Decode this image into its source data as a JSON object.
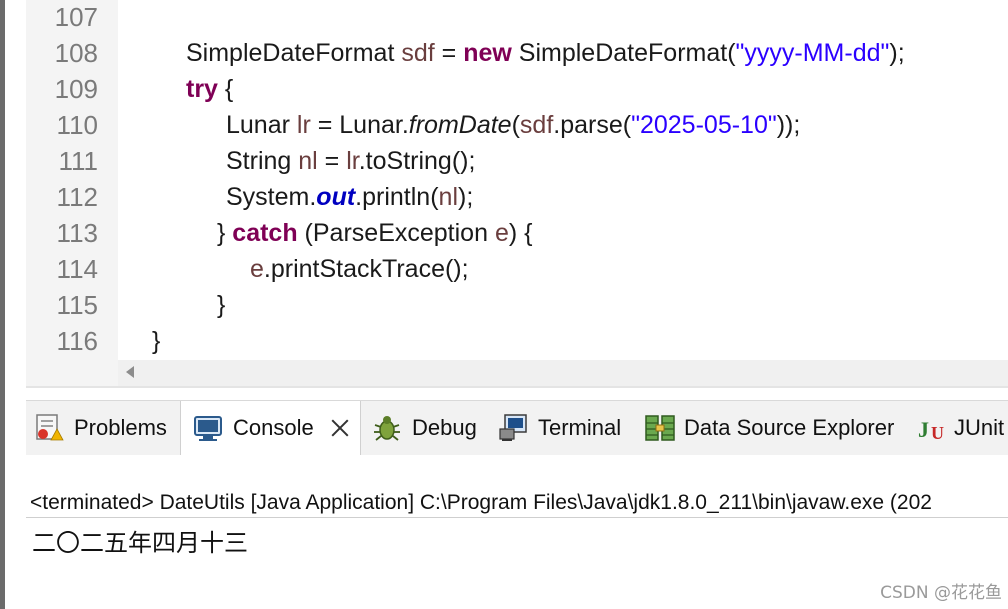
{
  "editor": {
    "lines": [
      {
        "num": "107"
      },
      {
        "num": "108",
        "t": [
          "SimpleDateFormat ",
          "sdf",
          " = ",
          "new",
          " SimpleDateFormat(",
          "\"yyyy-MM-dd\"",
          ");"
        ]
      },
      {
        "num": "109",
        "t": [
          "try",
          " {"
        ]
      },
      {
        "num": "110",
        "t": [
          "Lunar ",
          "lr",
          " = Lunar.",
          "fromDate",
          "(",
          "sdf",
          ".parse(",
          "\"2025-05-10\"",
          "));"
        ]
      },
      {
        "num": "111",
        "t": [
          "String ",
          "nl",
          " = ",
          "lr",
          ".toString();"
        ]
      },
      {
        "num": "112",
        "t": [
          "System.",
          "out",
          ".println(",
          "nl",
          ");"
        ]
      },
      {
        "num": "113",
        "t": [
          "} ",
          "catch",
          " (ParseException ",
          "e",
          ") {"
        ]
      },
      {
        "num": "114",
        "t": [
          "e",
          ".printStackTrace();"
        ]
      },
      {
        "num": "115",
        "t": [
          "}"
        ]
      },
      {
        "num": "116",
        "t": [
          "}"
        ]
      }
    ]
  },
  "tabs": [
    {
      "label": "Problems",
      "icon": "problems-icon"
    },
    {
      "label": "Console",
      "icon": "console-icon",
      "active": true
    },
    {
      "label": "Debug",
      "icon": "debug-icon"
    },
    {
      "label": "Terminal",
      "icon": "terminal-icon"
    },
    {
      "label": "Data Source Explorer",
      "icon": "data-source-explorer-icon"
    },
    {
      "label": "JUnit",
      "icon": "junit-icon"
    }
  ],
  "console": {
    "header": "<terminated> DateUtils [Java Application] C:\\Program Files\\Java\\jdk1.8.0_211\\bin\\javaw.exe  (202",
    "output": "二〇二五年四月十三"
  },
  "watermark": "CSDN @花花鱼",
  "colors": {
    "keyword": "#7f0055",
    "string": "#2a00ff",
    "local_var": "#6a3e3e",
    "static_field": "#0000c0"
  }
}
